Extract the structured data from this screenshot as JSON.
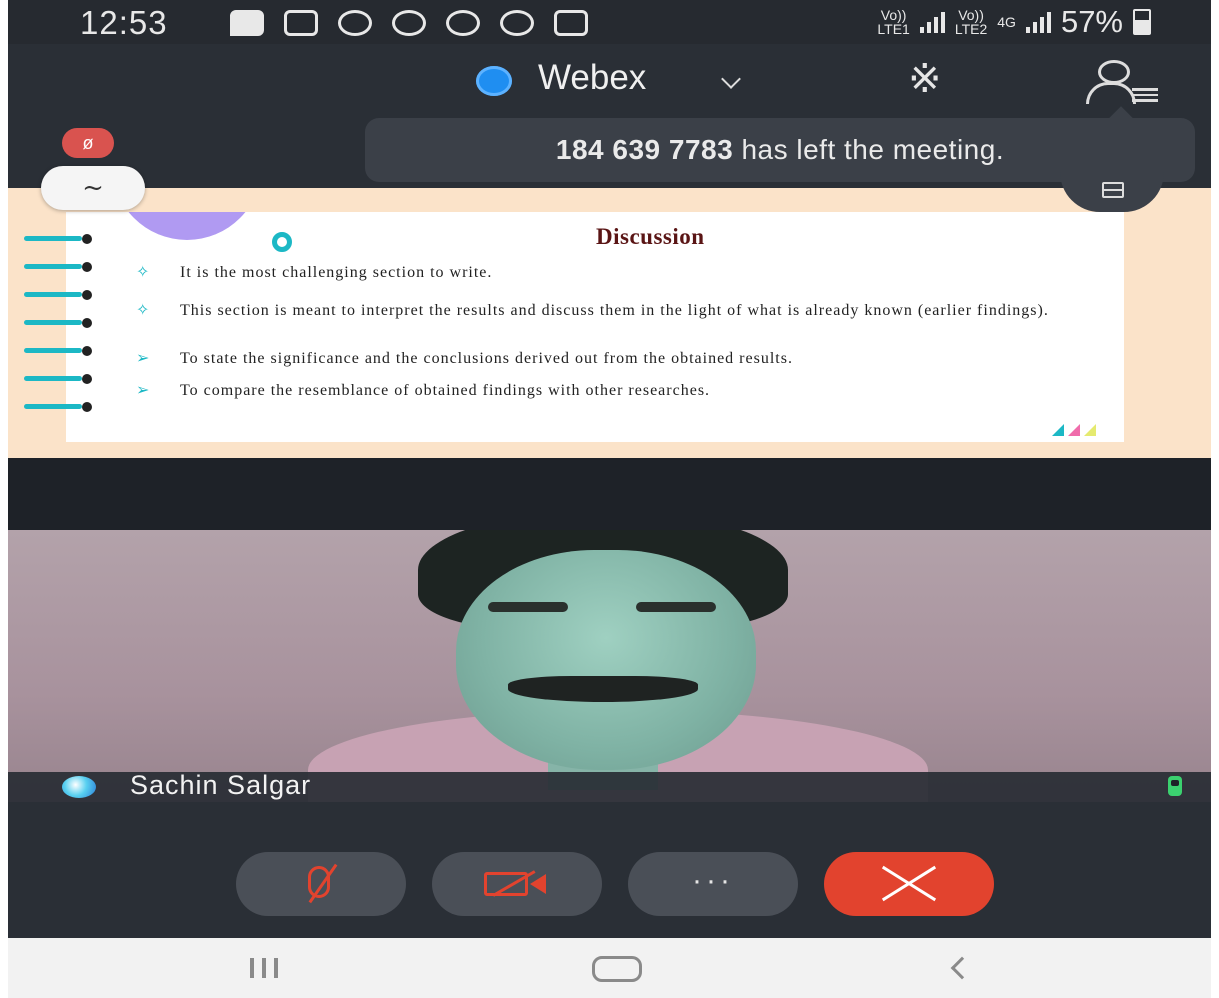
{
  "status_bar": {
    "time": "12:53",
    "sim1": "Vo))\nLTE1",
    "sim2": "Vo))\nLTE2",
    "network": "4G",
    "battery": "57%"
  },
  "header": {
    "app_title": "Webex"
  },
  "toast": {
    "participant": "184 639 7783",
    "message": "has left the meeting."
  },
  "share": {
    "annotate_glyph": "~",
    "mic_glyph": "ø"
  },
  "slide": {
    "title": "Discussion",
    "bullets": [
      {
        "marker": "✧",
        "text": "It is the most challenging section to write."
      },
      {
        "marker": "✧",
        "text": "This section is meant to interpret the results and discuss them in the light of what is already known (earlier findings)."
      },
      {
        "marker": "➢",
        "text": "To state the significance and the conclusions derived out from the obtained results."
      },
      {
        "marker": "➢",
        "text": " To compare the resemblance of obtained findings with other researches."
      }
    ]
  },
  "video": {
    "participant_name": "Sachin Salgar"
  },
  "controls": {
    "more_label": "···"
  },
  "colors": {
    "end_call": "#e2432e",
    "accent": "#1cb8c5",
    "header_bg": "#2a2f36"
  }
}
